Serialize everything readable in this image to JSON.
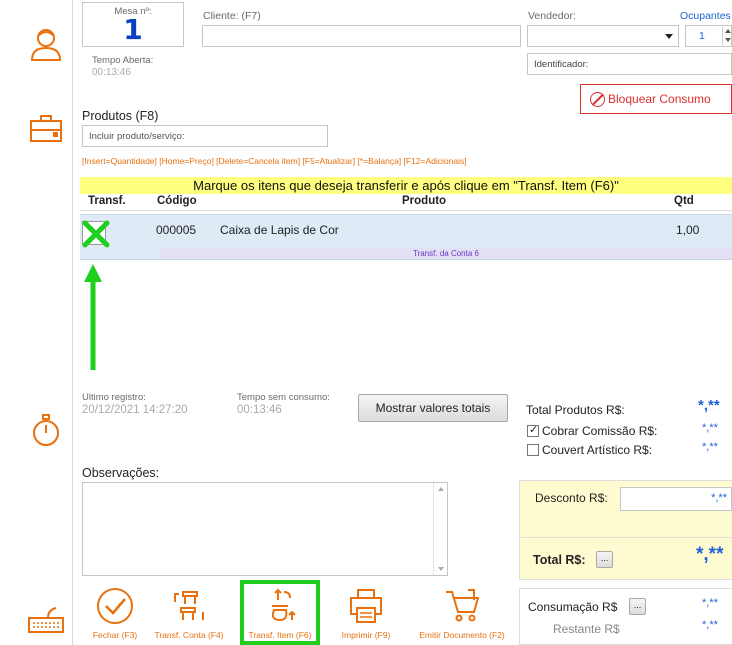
{
  "header": {
    "mesa_label": "Mesa nº:",
    "mesa_number": "1",
    "tempo_aberta_label": "Tempo Aberta:",
    "tempo_aberta_value": "00:13:46",
    "cliente_label": "Cliente: (F7)",
    "cliente_value": "",
    "vendedor_label": "Vendedor:",
    "vendedor_value": "",
    "ocupantes_label": "Ocupantes",
    "ocupantes_value": "1",
    "identificador_label": "Identificador:",
    "bloquear_label": "Bloquear Consumo"
  },
  "produtos": {
    "title": "Produtos (F8)",
    "search_placeholder": "Incluir produto/serviço:",
    "shortcuts": "[Insert=Quantidade] [Home=Preço] [Delete=Cancela item] [F5=Atualizar] [*=Balança] [F12=Adicionais]",
    "banner": "Marque os itens que deseja transferir e após clique em \"Transf. Item (F6)\"",
    "columns": {
      "transf": "Transf.",
      "codigo": "Código",
      "produto": "Produto",
      "qtd": "Qtd"
    },
    "rows": [
      {
        "codigo": "000005",
        "produto": "Caixa de Lapis de Cor",
        "qtd": "1,00",
        "note": "Transf. da Conta 6",
        "checked": true
      }
    ]
  },
  "status": {
    "ultimo_registro_label": "Ultimo registro:",
    "ultimo_registro_value": "20/12/2021 14:27:20",
    "tempo_sem_consumo_label": "Tempo sem consumo:",
    "tempo_sem_consumo_value": "00:13:46",
    "mostrar_valores_label": "Mostrar valores totais"
  },
  "totais": {
    "total_produtos_label": "Total Produtos R$:",
    "total_produtos_value": "*,**",
    "cobrar_comissao_label": "Cobrar Comissão R$:",
    "cobrar_comissao_value": "*,**",
    "couvert_label": "Couvert Artístico  R$:",
    "couvert_value": "*,**",
    "desconto_label": "Desconto R$:",
    "desconto_value": "*,**",
    "total_label": "Total R$:",
    "total_value": "*,**",
    "consumacao_label": "Consumação R$",
    "consumacao_value": "*,**",
    "restante_label": "Restante R$",
    "restante_value": "*,**",
    "ellipsis": "..."
  },
  "observacoes": {
    "label": "Observações:"
  },
  "toolbar": {
    "fechar": "Fechar (F3)",
    "transf_conta": "Transf. Conta (F4)",
    "transf_item": "Transf. Item (F6)",
    "imprimir": "Imprimir (F9)",
    "emitir": "Emitir Documento (F2)"
  },
  "colors": {
    "accent_orange": "#e8700f",
    "highlight_green": "#1ecf1e",
    "banner_yellow": "#ffff80",
    "mesa_blue": "#0a3fc4",
    "bloquear_red": "#d9302c"
  },
  "icons": [
    "user-icon",
    "briefcase-icon",
    "stopwatch-icon",
    "keyboard-icon",
    "check-circle-icon",
    "transfer-table-icon",
    "transfer-item-icon",
    "printer-icon",
    "cart-document-icon",
    "block-icon",
    "dropdown-arrow-icon",
    "spinner-icon",
    "green-arrow-up",
    "green-x-mark"
  ]
}
